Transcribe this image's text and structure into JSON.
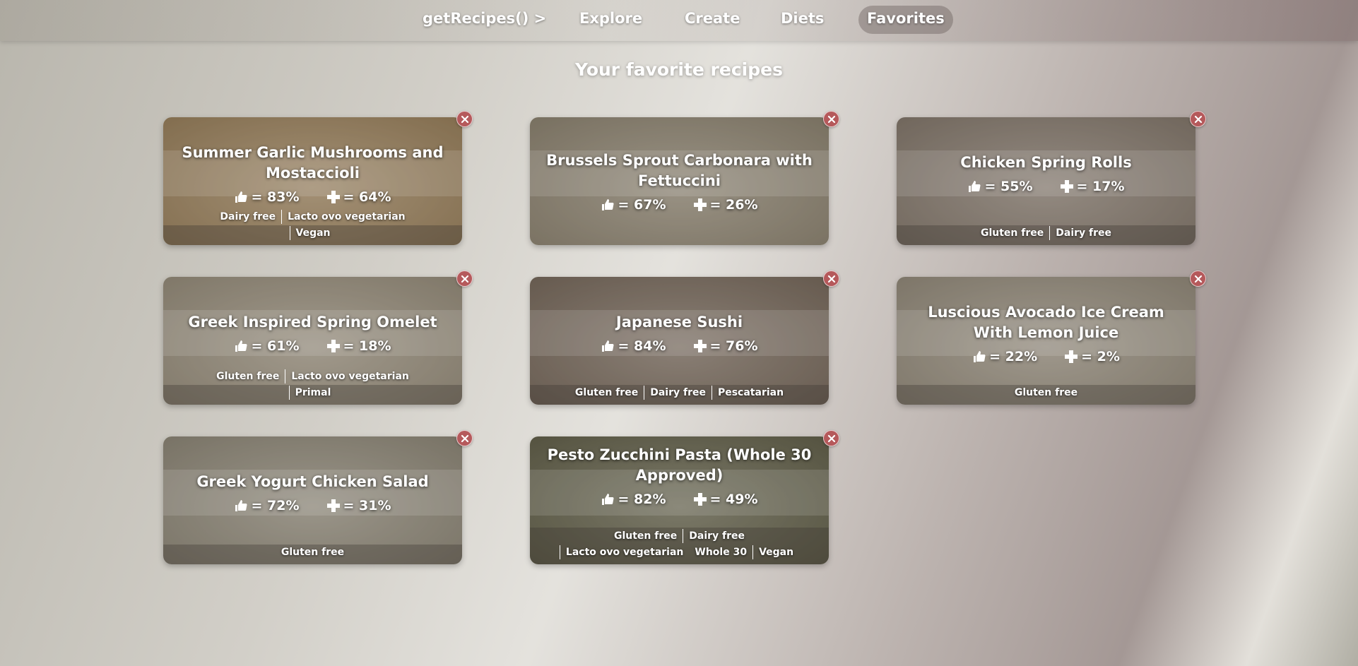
{
  "nav": {
    "brand": "getRecipes() >",
    "items": [
      "Explore",
      "Create",
      "Diets",
      "Favorites"
    ],
    "active": "Favorites"
  },
  "page": {
    "title": "Your favorite recipes"
  },
  "recipes": [
    {
      "title": "Summer Garlic Mushrooms and Mostaccioli",
      "likes": "= 83%",
      "health": "= 64%",
      "tags": [
        "Dairy free",
        "Lacto ovo vegetarian",
        "Vegan"
      ],
      "color": "#b99a6a"
    },
    {
      "title": "Brussels Sprout Carbonara with Fettuccini",
      "likes": "= 67%",
      "health": "= 26%",
      "tags": [],
      "color": "#a89e86"
    },
    {
      "title": "Chicken Spring Rolls",
      "likes": "= 55%",
      "health": "= 17%",
      "tags": [
        "Gluten free",
        "Dairy free"
      ],
      "color": "#9c8f80"
    },
    {
      "title": "Greek Inspired Spring Omelet",
      "likes": "= 61%",
      "health": "= 18%",
      "tags": [
        "Gluten free",
        "Lacto ovo vegetarian",
        "Primal"
      ],
      "color": "#b5ab94"
    },
    {
      "title": "Japanese Sushi",
      "likes": "= 84%",
      "health": "= 76%",
      "tags": [
        "Gluten free",
        "Dairy free",
        "Pescatarian"
      ],
      "color": "#8b7b6a"
    },
    {
      "title": "Luscious Avocado Ice Cream With Lemon Juice",
      "likes": "= 22%",
      "health": "= 2%",
      "tags": [
        "Gluten free"
      ],
      "color": "#b1a894"
    },
    {
      "title": "Greek Yogurt Chicken Salad",
      "likes": "= 72%",
      "health": "= 31%",
      "tags": [
        "Gluten free"
      ],
      "color": "#a9a38f"
    },
    {
      "title": "Pesto Zucchini Pasta (Whole 30 Approved)",
      "likes": "= 82%",
      "health": "= 49%",
      "tags": [
        "Gluten free",
        "Dairy free",
        "Lacto ovo vegetarian",
        "Whole 30",
        "Vegan"
      ],
      "color": "#6f6f52"
    }
  ]
}
